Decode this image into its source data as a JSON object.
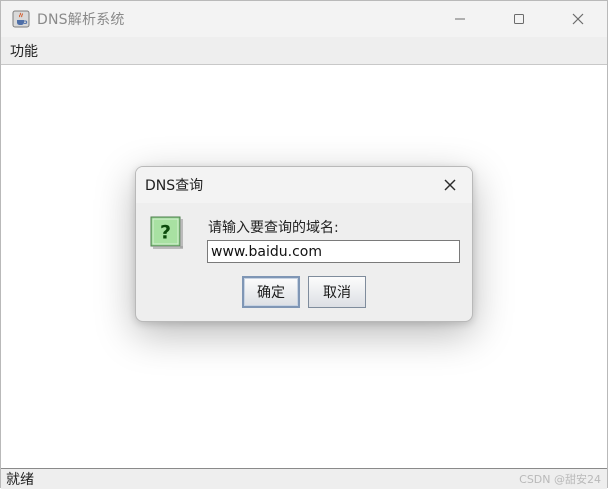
{
  "window": {
    "title": "DNS解析系统",
    "icon": "java-cup-icon"
  },
  "menubar": {
    "items": [
      {
        "label": "功能"
      }
    ]
  },
  "statusbar": {
    "text": "就绪",
    "watermark": "CSDN @甜安24"
  },
  "dialog": {
    "title": "DNS查询",
    "prompt": "请输入要查询的域名:",
    "input_value": "www.baidu.com",
    "ok_label": "确定",
    "cancel_label": "取消",
    "icon": "question-icon"
  },
  "colors": {
    "question_icon_bg": "#8fd18b",
    "question_icon_fg": "#0b4a0b"
  }
}
